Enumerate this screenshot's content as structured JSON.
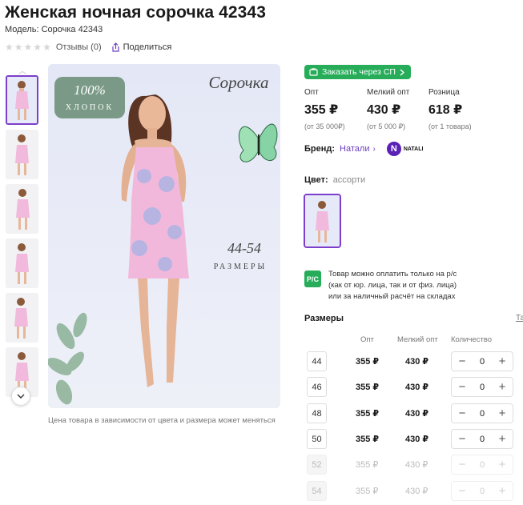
{
  "product": {
    "title": "Женская ночная сорочка 42343",
    "model": "Модель: Сорочка 42343",
    "reviews": "Отзывы (0)",
    "share": "Поделиться",
    "rating_stars": 5
  },
  "image": {
    "badge_percent": "100%",
    "badge_word": "ХЛОПОК",
    "script_title": "Сорочка",
    "size_range": "44-54",
    "size_word": "РАЗМЕРЫ",
    "note": "Цена товара в зависимости от цвета и размера может меняться"
  },
  "order": {
    "button_label": "Заказать через СП"
  },
  "prices": [
    {
      "label": "Опт",
      "value": "355 ₽",
      "sub": "(от 35 000₽)"
    },
    {
      "label": "Мелкий опт",
      "value": "430 ₽",
      "sub": "(от 5 000 ₽)"
    },
    {
      "label": "Розница",
      "value": "618 ₽",
      "sub": "(от 1 товара)"
    }
  ],
  "brand": {
    "label": "Бренд:",
    "name": "Натали",
    "logo_letter": "N",
    "logo_text": "NATALI"
  },
  "color": {
    "label": "Цвет:",
    "value": "ассорти"
  },
  "payment": {
    "icon_text": "Р/С",
    "line1": "Товар можно оплатить только на р/с",
    "line2": "(как от юр. лица, так и от физ. лица)",
    "line3": "или за наличный расчёт на складах"
  },
  "sizes": {
    "title": "Размеры",
    "table_link": "Та",
    "headers": {
      "opt": "Опт",
      "small": "Мелкий опт",
      "qty": "Количество"
    },
    "rows": [
      {
        "size": "44",
        "opt": "355 ₽",
        "small": "430 ₽",
        "qty": "0",
        "available": true
      },
      {
        "size": "46",
        "opt": "355 ₽",
        "small": "430 ₽",
        "qty": "0",
        "available": true
      },
      {
        "size": "48",
        "opt": "355 ₽",
        "small": "430 ₽",
        "qty": "0",
        "available": true
      },
      {
        "size": "50",
        "opt": "355 ₽",
        "small": "430 ₽",
        "qty": "0",
        "available": true
      },
      {
        "size": "52",
        "opt": "355 ₽",
        "small": "430 ₽",
        "qty": "0",
        "available": false
      },
      {
        "size": "54",
        "opt": "355 ₽",
        "small": "430 ₽",
        "qty": "0",
        "available": false
      }
    ]
  },
  "colors": {
    "accent_green": "#27ad5a",
    "accent_purple": "#7b3fcb",
    "badge_green": "#7a9a87"
  }
}
